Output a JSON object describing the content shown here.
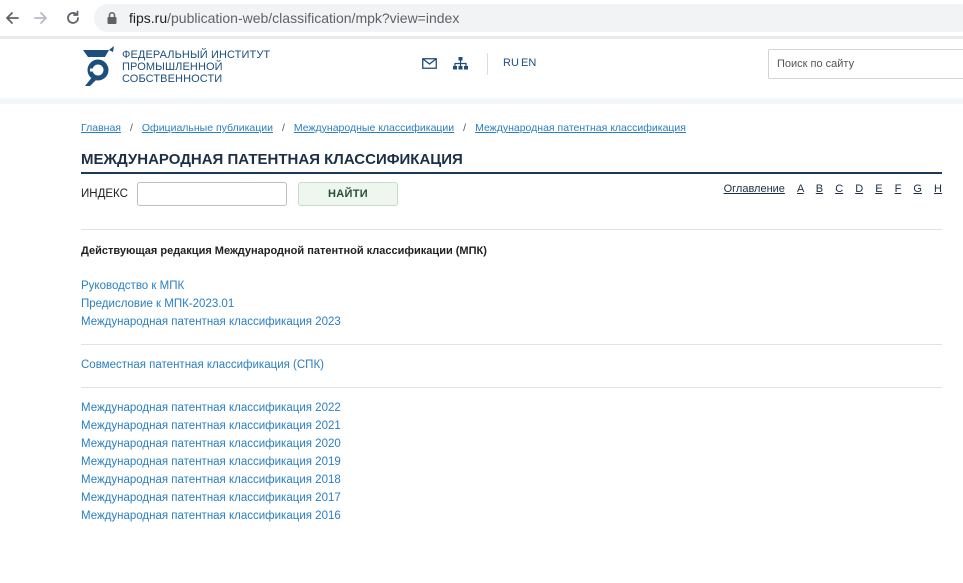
{
  "browser": {
    "url_host": "fips.ru",
    "url_path": "/publication-web/classification/mpk?view=index"
  },
  "header": {
    "logo_lines": [
      "ФЕДЕРАЛЬНЫЙ ИНСТИТУТ",
      "ПРОМЫШЛЕННОЙ",
      "СОБСТВЕННОСТИ"
    ],
    "lang_ru": "RU",
    "lang_en": "EN",
    "search_placeholder": "Поиск по сайту",
    "brand_color": "#1d4f7d"
  },
  "breadcrumb": [
    "Главная",
    "Официальные публикации",
    "Международные классификации",
    "Международная патентная классификация"
  ],
  "breadcrumb_sep": "/",
  "page_title": "МЕЖДУНАРОДНАЯ ПАТЕНТНАЯ КЛАССИФИКАЦИЯ",
  "index_form": {
    "label": "ИНДЕКС",
    "value": "",
    "button": "НАЙТИ"
  },
  "toc": {
    "label": "Оглавление",
    "letters": [
      "A",
      "B",
      "C",
      "D",
      "E",
      "F",
      "G",
      "H"
    ]
  },
  "current_section": {
    "heading": "Действующая редакция Международной патентной классификации (МПК)",
    "links": [
      "Руководство к МПК",
      "Предисловие к МПК-2023.01",
      "Международная патентная классификация 2023"
    ]
  },
  "spk_link": "Совместная патентная классификация (СПК)",
  "archive_links": [
    "Международная патентная классификация 2022",
    "Международная патентная классификация 2021",
    "Международная патентная классификация 2020",
    "Международная патентная классификация 2019",
    "Международная патентная классификация 2018",
    "Международная патентная классификация 2017",
    "Международная патентная классификация 2016"
  ]
}
